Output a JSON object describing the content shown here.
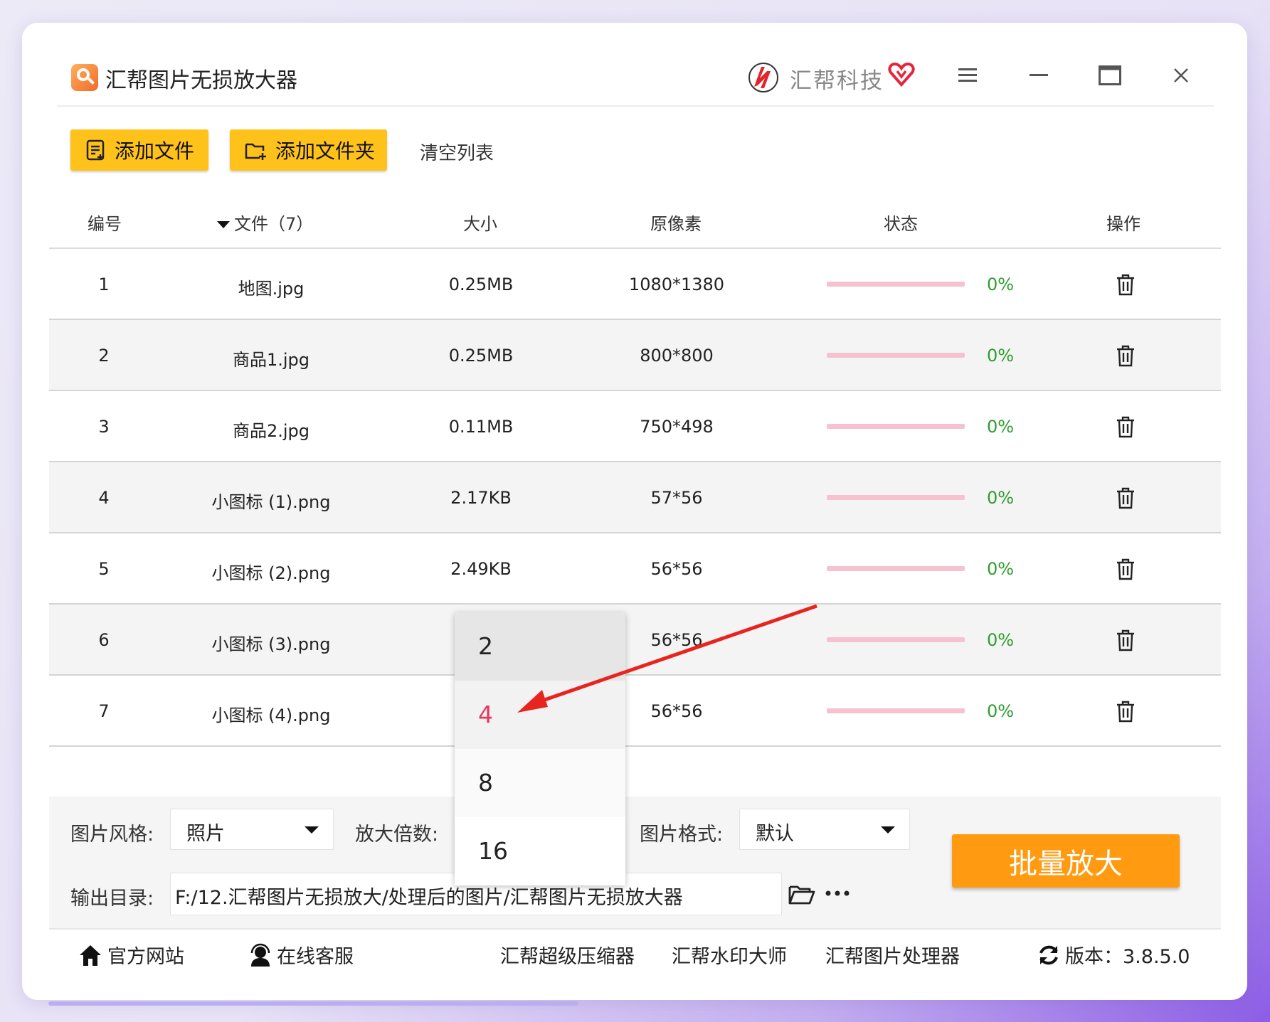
{
  "app": {
    "title": "汇帮图片无损放大器",
    "brand": "汇帮科技"
  },
  "toolbar": {
    "add_file": "添加文件",
    "add_folder": "添加文件夹",
    "clear_list": "清空列表"
  },
  "table": {
    "headers": {
      "index": "编号",
      "file": "文件（7）",
      "size": "大小",
      "pixels": "原像素",
      "status": "状态",
      "action": "操作"
    },
    "rows": [
      {
        "index": "1",
        "name": "地图.jpg",
        "size": "0.25MB",
        "pixels": "1080*1380",
        "progress": 0,
        "percent": "0%"
      },
      {
        "index": "2",
        "name": "商品1.jpg",
        "size": "0.25MB",
        "pixels": "800*800",
        "progress": 0,
        "percent": "0%"
      },
      {
        "index": "3",
        "name": "商品2.jpg",
        "size": "0.11MB",
        "pixels": "750*498",
        "progress": 0,
        "percent": "0%"
      },
      {
        "index": "4",
        "name": "小图标 (1).png",
        "size": "2.17KB",
        "pixels": "57*56",
        "progress": 0,
        "percent": "0%"
      },
      {
        "index": "5",
        "name": "小图标 (2).png",
        "size": "2.49KB",
        "pixels": "56*56",
        "progress": 0,
        "percent": "0%"
      },
      {
        "index": "6",
        "name": "小图标 (3).png",
        "size": "",
        "pixels": "56*56",
        "progress": 0,
        "percent": "0%"
      },
      {
        "index": "7",
        "name": "小图标 (4).png",
        "size": "",
        "pixels": "56*56",
        "progress": 0,
        "percent": "0%"
      }
    ]
  },
  "settings": {
    "style_label": "图片风格:",
    "style_value": "照片",
    "scale_label": "放大倍数:",
    "format_label": "图片格式:",
    "format_value": "默认",
    "output_label": "输出目录:",
    "output_path": "F:/12.汇帮图片无损放大/处理后的图片/汇帮图片无损放大器",
    "batch_button": "批量放大"
  },
  "scale_dropdown": {
    "options": [
      "2",
      "4",
      "8",
      "16"
    ],
    "selected": "4",
    "hovered": "2"
  },
  "footer": {
    "website": "官方网站",
    "support": "在线客服",
    "compressor": "汇帮超级压缩器",
    "watermark": "汇帮水印大师",
    "processor": "汇帮图片处理器",
    "version": "版本：3.8.5.0"
  },
  "colors": {
    "accent_yellow": "#ffc21a",
    "batch_orange": "#ff9a11",
    "progress_track": "#f6c2d0",
    "percent_green": "#2e9d2e",
    "selected_option": "#e8365e",
    "annotation_arrow": "#e8241f"
  }
}
